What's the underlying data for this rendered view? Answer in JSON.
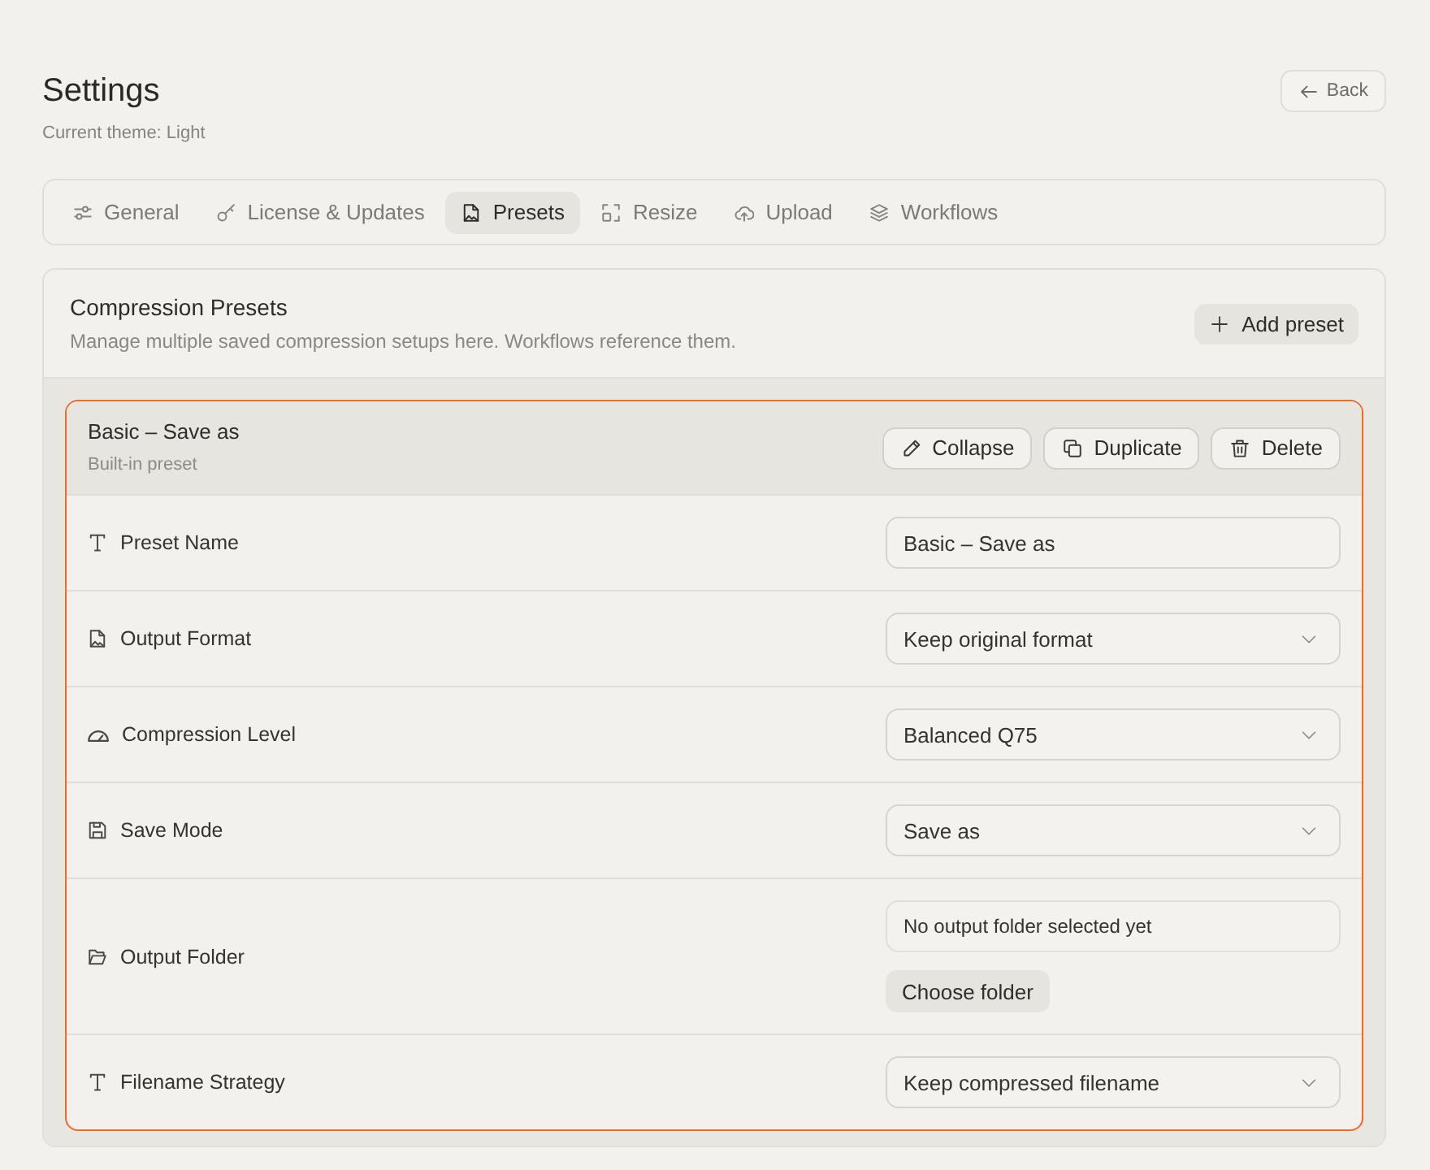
{
  "header": {
    "title": "Settings",
    "subtitle": "Current theme: Light",
    "back_button": "Back"
  },
  "tabs": [
    {
      "label": "General",
      "selected": false
    },
    {
      "label": "License & Updates",
      "selected": false
    },
    {
      "label": "Presets",
      "selected": true
    },
    {
      "label": "Resize",
      "selected": false
    },
    {
      "label": "Upload",
      "selected": false
    },
    {
      "label": "Workflows",
      "selected": false
    }
  ],
  "section": {
    "title": "Compression Presets",
    "description": "Manage multiple saved compression setups here. Workflows reference them.",
    "add_button": "Add preset"
  },
  "presets": [
    {
      "title": "Basic – Save as",
      "subtitle": "Built-in preset",
      "selected": true,
      "actions": [
        "Collapse",
        "Duplicate",
        "Delete"
      ],
      "fields": [
        {
          "label": "Preset Name",
          "kind": "text",
          "value": "Basic – Save as"
        },
        {
          "label": "Output Format",
          "kind": "select",
          "value": "Keep original format"
        },
        {
          "label": "Compression Level",
          "kind": "select",
          "value": "Balanced Q75"
        },
        {
          "label": "Save Mode",
          "kind": "select",
          "value": "Save as"
        },
        {
          "label": "Output Folder",
          "kind": "folder",
          "value": "No output folder selected yet",
          "button": "Choose folder"
        },
        {
          "label": "Filename Strategy",
          "kind": "select",
          "value": "Keep compressed filename"
        }
      ]
    }
  ]
}
